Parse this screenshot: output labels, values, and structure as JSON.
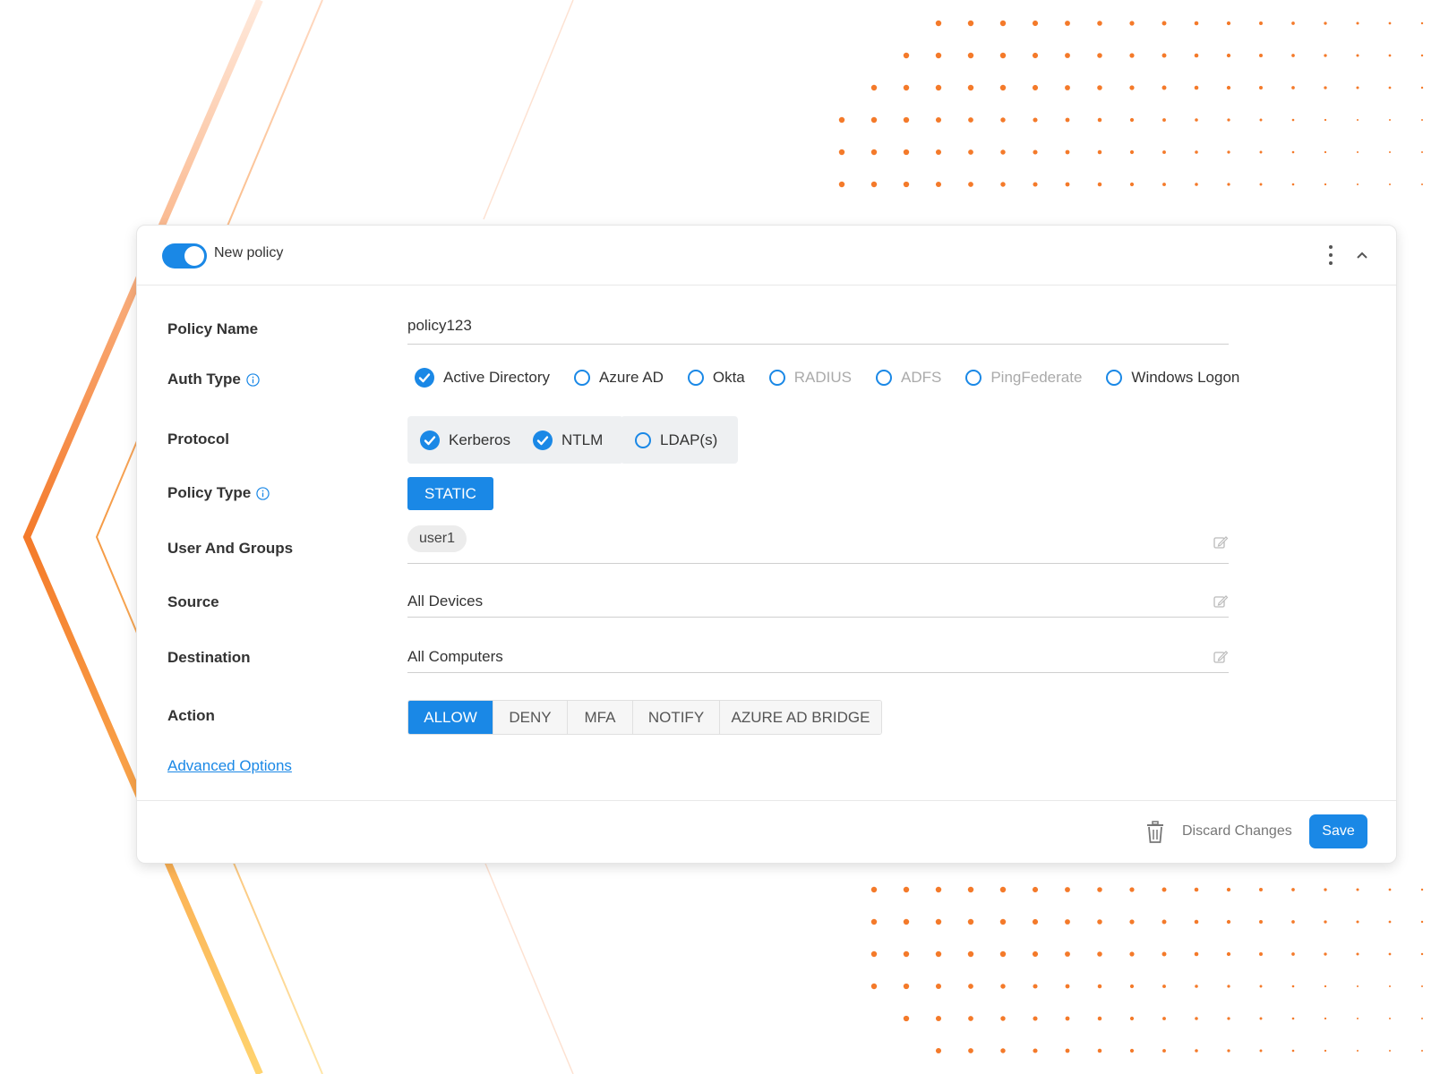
{
  "header": {
    "title": "New policy",
    "toggle_on": true
  },
  "form": {
    "policy_name": {
      "label": "Policy Name",
      "value": "policy123"
    },
    "auth_type": {
      "label": "Auth Type",
      "options": [
        {
          "label": "Active Directory",
          "checked": true,
          "disabled": false
        },
        {
          "label": "Azure AD",
          "checked": false,
          "disabled": false
        },
        {
          "label": "Okta",
          "checked": false,
          "disabled": false
        },
        {
          "label": "RADIUS",
          "checked": false,
          "disabled": true
        },
        {
          "label": "ADFS",
          "checked": false,
          "disabled": true
        },
        {
          "label": "PingFederate",
          "checked": false,
          "disabled": true
        },
        {
          "label": "Windows Logon",
          "checked": false,
          "disabled": false
        }
      ]
    },
    "protocol": {
      "label": "Protocol",
      "options": [
        {
          "label": "Kerberos",
          "checked": true
        },
        {
          "label": "NTLM",
          "checked": true
        },
        {
          "label": "LDAP(s)",
          "checked": false
        }
      ]
    },
    "policy_type": {
      "label": "Policy Type",
      "value": "STATIC"
    },
    "users_and_groups": {
      "label": "User And Groups",
      "chip": "user1"
    },
    "source": {
      "label": "Source",
      "value": "All Devices"
    },
    "destination": {
      "label": "Destination",
      "value": "All Computers"
    },
    "action": {
      "label": "Action",
      "options": [
        "ALLOW",
        "DENY",
        "MFA",
        "NOTIFY",
        "AZURE AD BRIDGE"
      ],
      "selected": "ALLOW"
    },
    "advanced_link": "Advanced Options"
  },
  "footer": {
    "discard_label": "Discard Changes",
    "save_label": "Save"
  },
  "colors": {
    "accent": "#1a88e6",
    "orange": "#f47a2a",
    "yellow": "#ffd470"
  }
}
